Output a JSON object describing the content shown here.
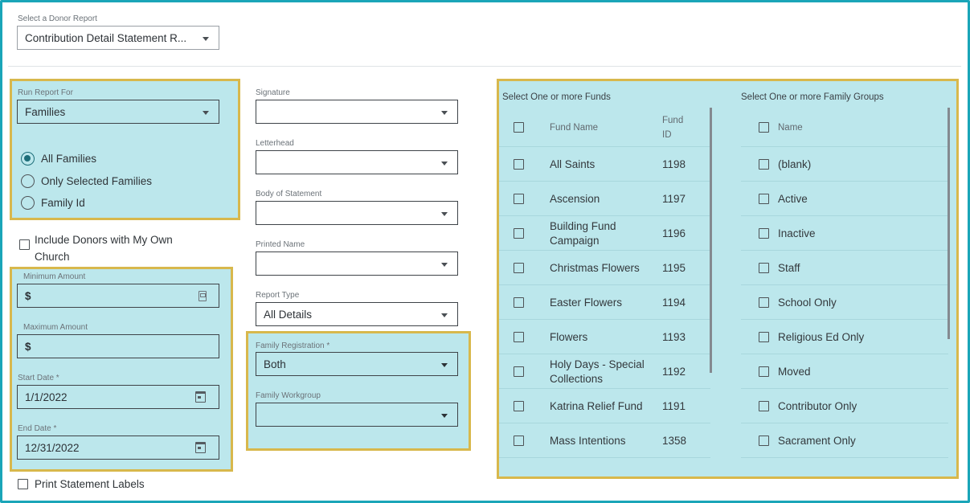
{
  "donor_report": {
    "label": "Select a Donor Report",
    "value": "Contribution Detail Statement R..."
  },
  "run_report_for": {
    "label": "Run Report For",
    "value": "Families",
    "options": [
      {
        "label": "All Families",
        "selected": true
      },
      {
        "label": "Only Selected Families",
        "selected": false
      },
      {
        "label": "Family Id",
        "selected": false
      }
    ]
  },
  "include_donors": {
    "label_line1": "Include Donors with My Own",
    "label_line2": "Church",
    "checked": false
  },
  "amounts": {
    "min_label": "Minimum Amount",
    "min_prefix": "$",
    "max_label": "Maximum Amount",
    "max_prefix": "$"
  },
  "dates": {
    "start_label": "Start Date *",
    "start_value": "1/1/2022",
    "end_label": "End Date *",
    "end_value": "12/31/2022"
  },
  "print_labels": {
    "label": "Print Statement Labels",
    "checked": false
  },
  "middle": {
    "signature_label": "Signature",
    "signature_value": "",
    "letterhead_label": "Letterhead",
    "letterhead_value": "",
    "body_label": "Body of Statement",
    "body_value": "",
    "printed_name_label": "Printed Name",
    "printed_name_value": "",
    "report_type_label": "Report Type",
    "report_type_value": "All Details",
    "family_registration_label": "Family Registration *",
    "family_registration_value": "Both",
    "family_workgroup_label": "Family Workgroup",
    "family_workgroup_value": ""
  },
  "funds": {
    "title": "Select One or more Funds",
    "col_name": "Fund Name",
    "col_id_line1": "Fund",
    "col_id_line2": "ID",
    "rows": [
      {
        "name_line1": "All Saints",
        "name_line2": "",
        "id": "1198"
      },
      {
        "name_line1": "Ascension",
        "name_line2": "",
        "id": "1197"
      },
      {
        "name_line1": "Building Fund",
        "name_line2": "Campaign",
        "id": "1196"
      },
      {
        "name_line1": "Christmas Flowers",
        "name_line2": "",
        "id": "1195"
      },
      {
        "name_line1": "Easter Flowers",
        "name_line2": "",
        "id": "1194"
      },
      {
        "name_line1": "Flowers",
        "name_line2": "",
        "id": "1193"
      },
      {
        "name_line1": "Holy Days - Special",
        "name_line2": "Collections",
        "id": "1192"
      },
      {
        "name_line1": "Katrina Relief Fund",
        "name_line2": "",
        "id": "1191"
      },
      {
        "name_line1": "Mass Intentions",
        "name_line2": "",
        "id": "1358"
      }
    ]
  },
  "family_groups": {
    "title": "Select One or more Family Groups",
    "col_name": "Name",
    "rows": [
      "(blank)",
      "Active",
      "Inactive",
      "Staff",
      "School Only",
      "Religious Ed Only",
      "Moved",
      "Contributor Only",
      "Sacrament Only"
    ]
  },
  "colors": {
    "frame": "#1aa5b8",
    "highlight": "#bce7ec",
    "highlight_border": "#d8b84c",
    "selected_radio": "#1d6e79"
  }
}
